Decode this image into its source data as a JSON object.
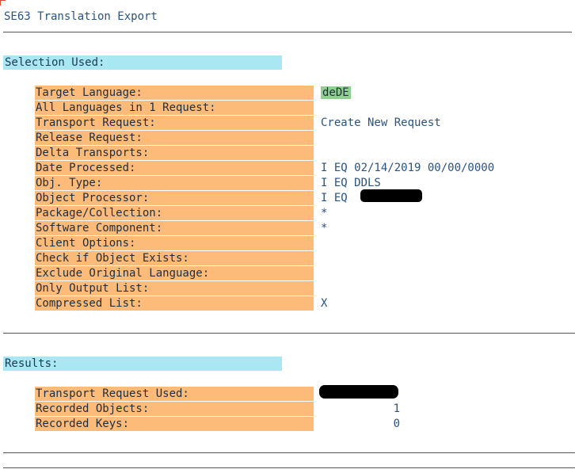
{
  "header": {
    "title": "SE63 Translation Export"
  },
  "selection": {
    "heading": "Selection Used:",
    "rows": [
      {
        "label": "Target Language:",
        "value": "deDE"
      },
      {
        "label": "All Languages in 1 Request:",
        "value": ""
      },
      {
        "label": "Transport Request:",
        "value": "Create New Request"
      },
      {
        "label": "Release Request:",
        "value": ""
      },
      {
        "label": "Delta Transports:",
        "value": ""
      },
      {
        "label": "Date Processed:",
        "value": "I EQ 02/14/2019 00/00/0000"
      },
      {
        "label": "Obj. Type:",
        "value": "I EQ DDLS"
      },
      {
        "label": "Object Processor:",
        "value": "I EQ"
      },
      {
        "label": "Package/Collection:",
        "value": "*"
      },
      {
        "label": "Software Component:",
        "value": "*"
      },
      {
        "label": "Client Options:",
        "value": ""
      },
      {
        "label": "Check if Object Exists:",
        "value": ""
      },
      {
        "label": "Exclude Original Language:",
        "value": ""
      },
      {
        "label": "Only Output List:",
        "value": ""
      },
      {
        "label": "Compressed List:",
        "value": "X"
      }
    ]
  },
  "results": {
    "heading": "Results:",
    "rows": [
      {
        "label": "Transport Request Used:",
        "value": ""
      },
      {
        "label": "Recorded Objects:",
        "value": "1"
      },
      {
        "label": "Recorded Keys:",
        "value": "0"
      }
    ]
  }
}
